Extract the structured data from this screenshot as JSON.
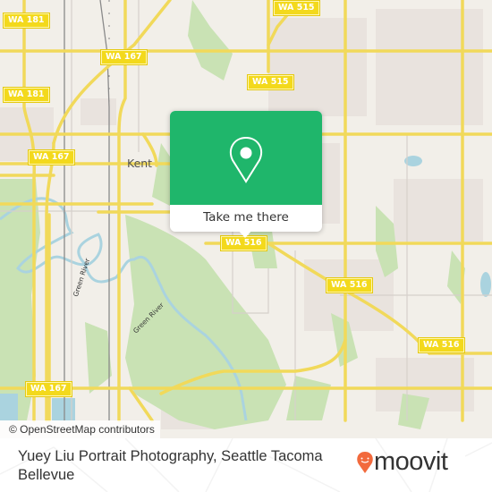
{
  "map": {
    "road_labels": [
      {
        "id": "wa181-top",
        "text": "WA 181"
      },
      {
        "id": "wa181-mid",
        "text": "WA 181"
      },
      {
        "id": "wa167-top",
        "text": "WA 167"
      },
      {
        "id": "wa167-left",
        "text": "WA 167"
      },
      {
        "id": "wa167-bottom",
        "text": "WA 167"
      },
      {
        "id": "wa515-top",
        "text": "WA 515"
      },
      {
        "id": "wa515-mid",
        "text": "WA 515"
      },
      {
        "id": "wa516-popup",
        "text": "WA 516"
      },
      {
        "id": "wa516-mid",
        "text": "WA 516"
      },
      {
        "id": "wa516-right",
        "text": "WA 516"
      }
    ],
    "place_labels": [
      {
        "id": "kent",
        "text": "Kent"
      }
    ],
    "water_labels": [
      {
        "id": "green-river-1",
        "text": "Green River"
      },
      {
        "id": "green-river-2",
        "text": "Green River"
      }
    ],
    "attribution": "© OpenStreetMap contributors"
  },
  "popup": {
    "icon": "map-pin-icon",
    "button_label": "Take me there",
    "color": "#1fb66b"
  },
  "footer": {
    "title": "Yuey Liu Portrait Photography, Seattle Tacoma Bellevue",
    "brand": "moovit",
    "brand_color": "#f26a3d"
  }
}
